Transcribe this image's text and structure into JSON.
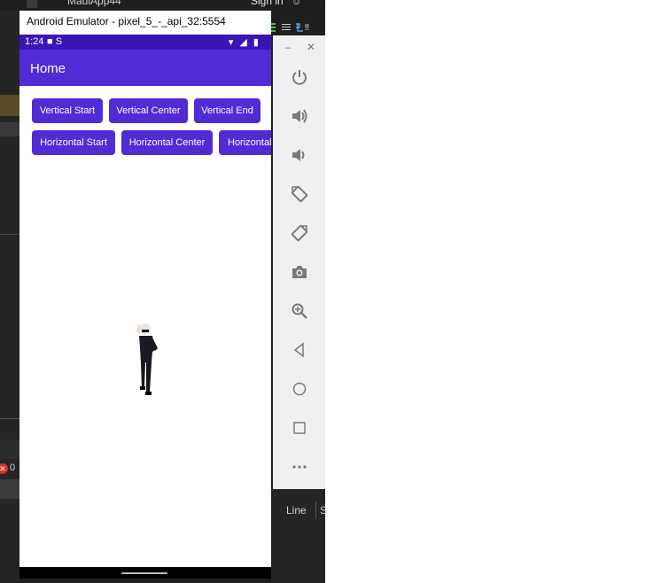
{
  "ide": {
    "title": "MauiApp44",
    "sign_in": "Sign in",
    "error_count": "0",
    "status_line": "Line",
    "status_col": "S"
  },
  "emulator": {
    "title": "Android Emulator - pixel_5_-_api_32:5554",
    "status": {
      "time": "1:24",
      "left_icons": "■ S",
      "right_icons": "▾ ◢ ▮"
    },
    "app": {
      "title": "Home",
      "buttons_row1": [
        "Vertical Start",
        "Vertical Center",
        "Vertical End"
      ],
      "buttons_row2": [
        "Horizontal Start",
        "Horizontal Center",
        "Horizontal"
      ]
    },
    "sidebar": {
      "minimize": "–",
      "close": "✕",
      "controls": [
        "power-icon",
        "volume-up-icon",
        "volume-down-icon",
        "rotate-left-icon",
        "rotate-right-icon",
        "camera-icon",
        "zoom-icon",
        "back-icon",
        "home-icon",
        "overview-icon",
        "more-icon"
      ]
    }
  },
  "colors": {
    "primary": "#512BD4",
    "status_bar": "#3B14B6",
    "ide_bg": "#1F1F1F",
    "toolbar_bg": "#F0F0F0",
    "icon_gray": "#7A7A7A"
  }
}
